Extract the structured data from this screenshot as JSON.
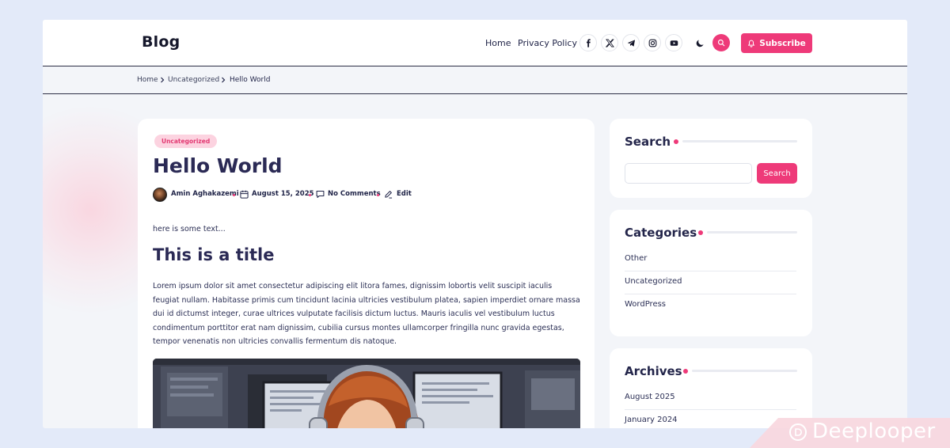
{
  "header": {
    "logo": "Blog",
    "nav": [
      "Home",
      "Privacy Policy"
    ],
    "social_icons": [
      "facebook-icon",
      "x-icon",
      "telegram-icon",
      "instagram-icon",
      "youtube-icon"
    ],
    "subscribe_label": "Subscribe",
    "accent_color": "#ee3a79"
  },
  "breadcrumb": [
    "Home",
    "Uncategorized",
    "Hello World"
  ],
  "post": {
    "category": "Uncategorized",
    "title": "Hello World",
    "author": "Amin Aghakazemi",
    "date": "August 15, 2025",
    "comments": "No Comments",
    "edit": "Edit",
    "intro": "here is some text...",
    "subtitle": "This is a title",
    "paragraph_lines": [
      "Lorem ipsum dolor sit amet consectetur adipiscing elit litora fames, dignissim lobortis velit suscipit iaculis",
      "feugiat nullam. Habitasse primis cum tincidunt lacinia ultricies vestibulum platea, sapien imperdiet ornare massa",
      "dui id dictumst integer, curae ultrices vulputate facilisis dictum luctus. Mauris iaculis vel vestibulum luctus",
      "condimentum porttitor erat nam dignissim, cubilia cursus montes ullamcorper fringilla nunc gravida egestas,",
      "tempor venenatis non ultricies convallis fermentum dis natoque."
    ]
  },
  "sidebar": {
    "search": {
      "title": "Search",
      "button": "Search",
      "value": ""
    },
    "categories": {
      "title": "Categories",
      "items": [
        "Other",
        "Uncategorized",
        "WordPress"
      ]
    },
    "archives": {
      "title": "Archives",
      "items": [
        "August 2025",
        "January 2024"
      ]
    }
  },
  "watermark": "Deeplooper"
}
